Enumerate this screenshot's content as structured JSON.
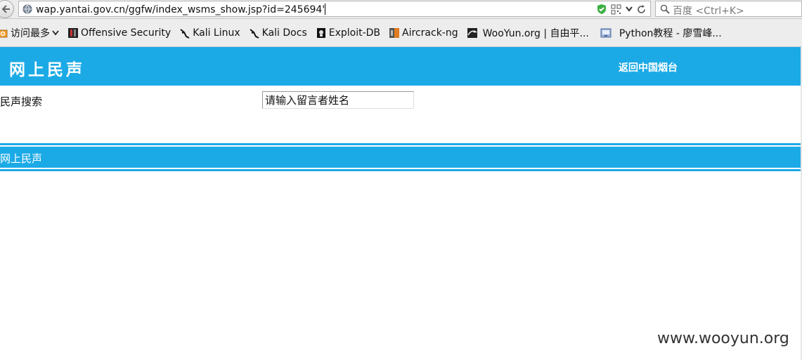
{
  "browser": {
    "url": "wap.yantai.gov.cn/ggfw/index_wsms_show.jsp?id=245694'",
    "search_placeholder": "百度 <Ctrl+K>"
  },
  "bookmarks": [
    {
      "label": "访问最多",
      "icon": "most-visited-folder-icon"
    },
    {
      "label": "Offensive Security",
      "icon": "offensive-security-icon"
    },
    {
      "label": "Kali Linux",
      "icon": "kali-dragon-icon"
    },
    {
      "label": "Kali Docs",
      "icon": "kali-dragon-icon"
    },
    {
      "label": "Exploit-DB",
      "icon": "exploit-db-icon"
    },
    {
      "label": "Aircrack-ng",
      "icon": "aircrack-icon"
    },
    {
      "label": "WooYun.org | 自由平...",
      "icon": "wooyun-icon"
    },
    {
      "label": "Python教程 - 廖雪峰...",
      "icon": "python-tutorial-icon"
    }
  ],
  "header": {
    "title": "网上民声",
    "home_link": "返回中国烟台"
  },
  "search": {
    "label": "民声搜索",
    "placeholder": "请输入留言者姓名"
  },
  "footer": {
    "text": "网上民声"
  },
  "watermark": "www.wooyun.org",
  "colors": {
    "brand": "#1caae6"
  }
}
